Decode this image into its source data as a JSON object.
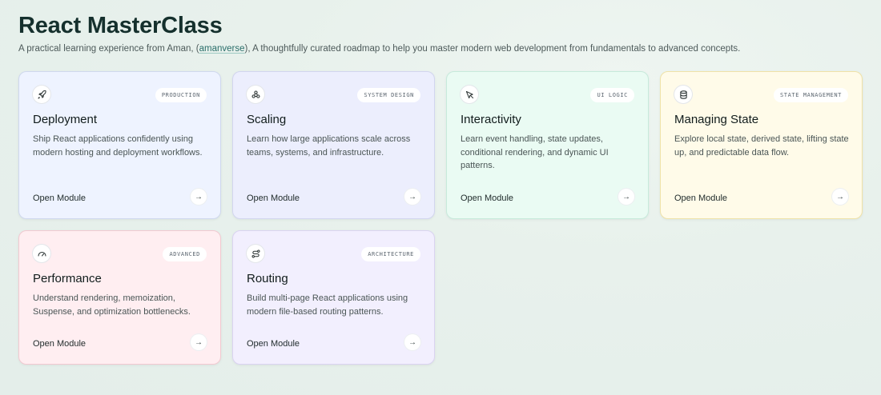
{
  "header": {
    "title": "React MasterClass",
    "subtitle_before": "A practical learning experience from Aman, (",
    "subtitle_link": "amanverse",
    "subtitle_after": "), A thoughtfully curated roadmap to help you master modern web development from fundamentals to advanced concepts."
  },
  "cards": [
    {
      "icon": "rocket-icon",
      "badge": "PRODUCTION",
      "title": "Deployment",
      "desc": "Ship React applications confidently using modern hosting and deployment workflows.",
      "link": "Open Module",
      "arrow": "→"
    },
    {
      "icon": "scaling-icon",
      "badge": "SYSTEM DESIGN",
      "title": "Scaling",
      "desc": "Learn how large applications scale across teams, systems, and infrastructure.",
      "link": "Open Module",
      "arrow": "→"
    },
    {
      "icon": "cursor-icon",
      "badge": "UI LOGIC",
      "title": "Interactivity",
      "desc": "Learn event handling, state updates, conditional rendering, and dynamic UI patterns.",
      "link": "Open Module",
      "arrow": "→"
    },
    {
      "icon": "database-icon",
      "badge": "STATE MANAGEMENT",
      "title": "Managing State",
      "desc": "Explore local state, derived state, lifting state up, and predictable data flow.",
      "link": "Open Module",
      "arrow": "→"
    },
    {
      "icon": "gauge-icon",
      "badge": "ADVANCED",
      "title": "Performance",
      "desc": "Understand rendering, memoization, Suspense, and optimization bottlenecks.",
      "link": "Open Module",
      "arrow": "→"
    },
    {
      "icon": "route-icon",
      "badge": "ARCHITECTURE",
      "title": "Routing",
      "desc": "Build multi-page React applications using modern file-based routing patterns.",
      "link": "Open Module",
      "arrow": "→"
    }
  ]
}
